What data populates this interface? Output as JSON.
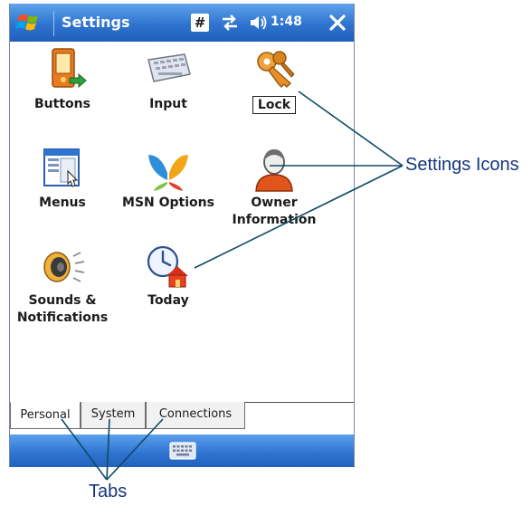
{
  "title_bar": {
    "app_title": "Settings",
    "input_indicator": "#",
    "time": "1:48",
    "icons": [
      "windows-start-icon",
      "hash-icon",
      "connectivity-icon",
      "volume-icon",
      "close-icon"
    ]
  },
  "settings_items": [
    {
      "label": "Buttons",
      "icon": "buttons-icon"
    },
    {
      "label": "Input",
      "icon": "keyboard-icon"
    },
    {
      "label": "Lock",
      "icon": "keys-icon",
      "selected": true
    },
    {
      "label": "Menus",
      "icon": "menus-icon"
    },
    {
      "label": "MSN Options",
      "icon": "msn-butterfly-icon"
    },
    {
      "label": "Owner Information",
      "label_line1": "Owner",
      "label_line2": "Information",
      "icon": "owner-icon"
    },
    {
      "label": "Sounds & Notifications",
      "label_line1": "Sounds &",
      "label_line2": "Notifications",
      "icon": "speaker-icon"
    },
    {
      "label": "Today",
      "icon": "today-icon"
    }
  ],
  "tabs": [
    {
      "label": "Personal",
      "active": true
    },
    {
      "label": "System",
      "active": false
    },
    {
      "label": "Connections",
      "active": false
    }
  ],
  "bottom_bar": {
    "icon": "keyboard-icon"
  },
  "annotations": {
    "settings_icons_callout": "Settings Icons",
    "tabs_callout": "Tabs"
  },
  "colors": {
    "title_bar": "#2f74cf",
    "callout_text": "#14357f",
    "callout_line": "#0e4b66"
  }
}
